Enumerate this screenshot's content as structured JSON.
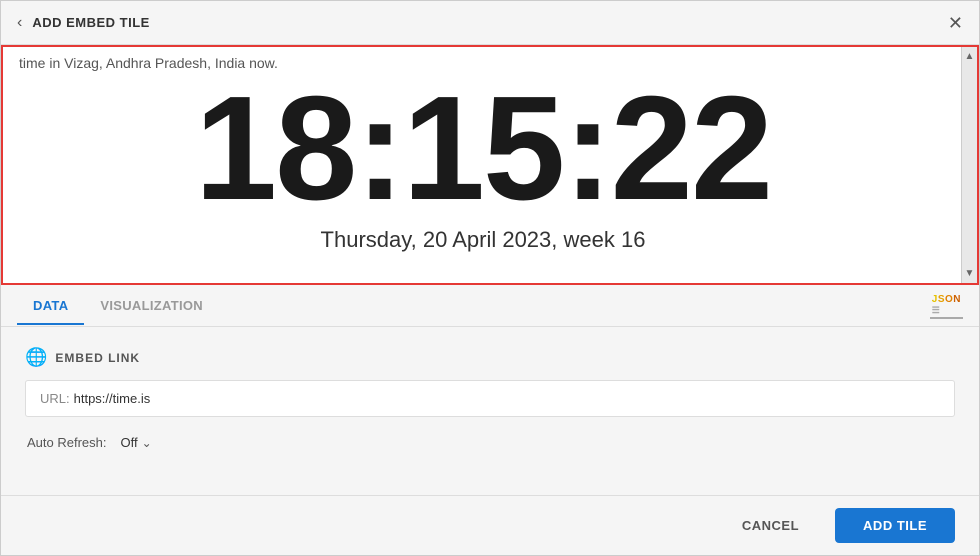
{
  "header": {
    "title": "ADD EMBED TILE",
    "back_icon": "‹",
    "close_icon": "✕"
  },
  "preview": {
    "subtitle_text": "time in Vizag, Andhra Pradesh, India now.",
    "clock_time": "18:15:22",
    "date_text": "Thursday, 20 April 2023, week 16"
  },
  "tabs": [
    {
      "label": "DATA",
      "active": true
    },
    {
      "label": "VISUALIZATION",
      "active": false
    }
  ],
  "json_badge": "JSON",
  "embed_link": {
    "section_label": "EMBED LINK",
    "url_label": "URL:",
    "url_value": "https://time.is"
  },
  "auto_refresh": {
    "label": "Auto Refresh:",
    "value": "Off"
  },
  "footer": {
    "cancel_label": "CANCEL",
    "add_tile_label": "ADD TILE"
  }
}
